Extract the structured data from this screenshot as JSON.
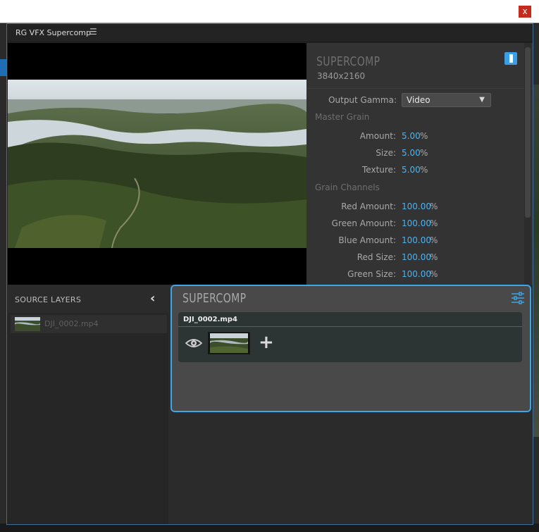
{
  "outer_window": {
    "close_label": "x"
  },
  "panel": {
    "title": "RG VFX Supercomp",
    "menu_icon": "hamburger-menu-icon"
  },
  "inspector": {
    "title": "SUPERCOMP",
    "resolution": "3840x2160",
    "output_gamma": {
      "label": "Output Gamma:",
      "value": "Video"
    },
    "sections": {
      "master_grain": "Master Grain",
      "grain_channels": "Grain Channels"
    },
    "master_grain": [
      {
        "label": "Amount:",
        "value": "5.00",
        "unit": "%"
      },
      {
        "label": "Size:",
        "value": "5.00",
        "unit": "%"
      },
      {
        "label": "Texture:",
        "value": "5.00",
        "unit": "%"
      }
    ],
    "grain_channels": [
      {
        "label": "Red Amount:",
        "value": "100.00",
        "unit": "%"
      },
      {
        "label": "Green Amount:",
        "value": "100.00",
        "unit": "%"
      },
      {
        "label": "Blue Amount:",
        "value": "100.00",
        "unit": "%"
      },
      {
        "label": "Red Size:",
        "value": "100.00",
        "unit": "%"
      },
      {
        "label": "Green Size:",
        "value": "100.00",
        "unit": "%"
      }
    ],
    "accent_color": "#4fb3ef"
  },
  "source_layers": {
    "title": "SOURCE LAYERS",
    "items": [
      {
        "label": "DJI_0002.mp4"
      }
    ]
  },
  "supercomp": {
    "title": "SUPERCOMP",
    "layers": [
      {
        "name": "DJI_0002.mp4"
      }
    ],
    "border_color": "#3ba6e8"
  }
}
